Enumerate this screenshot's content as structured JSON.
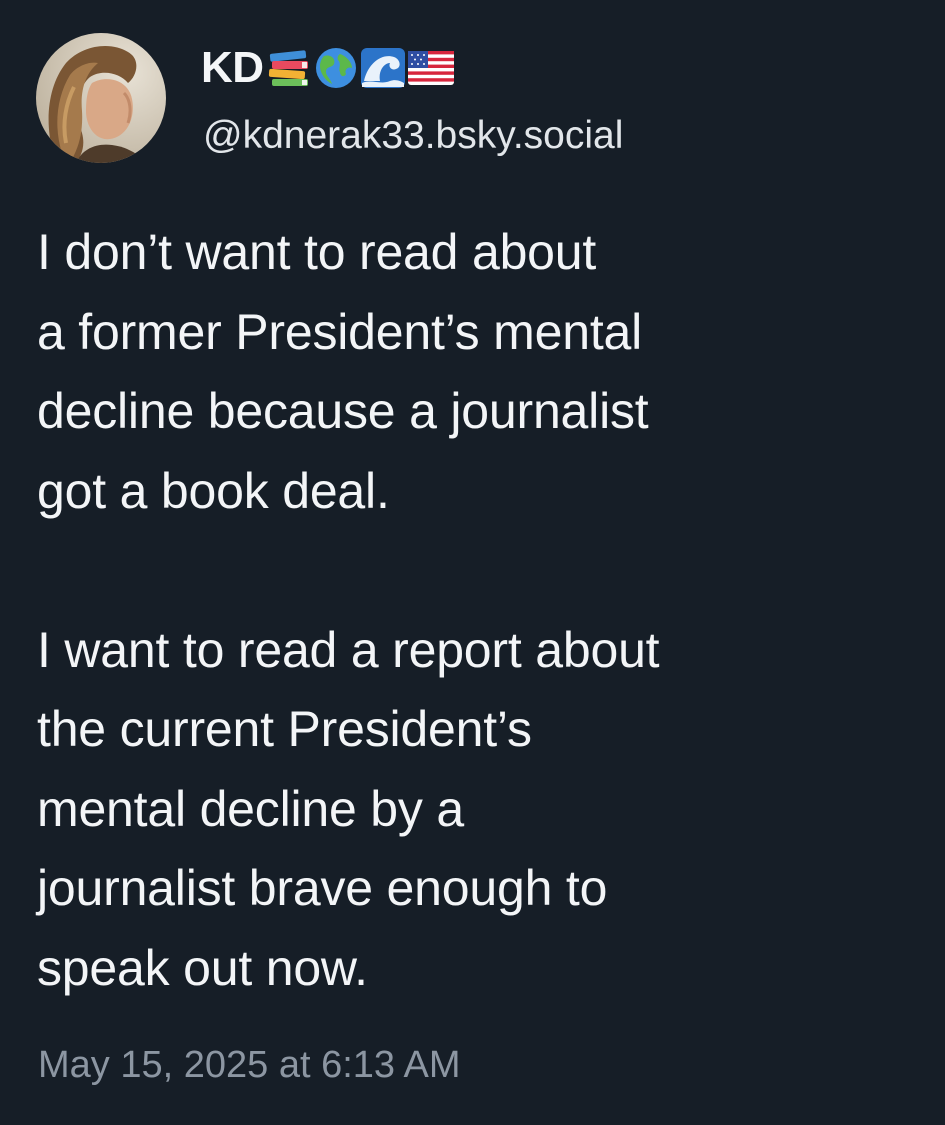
{
  "author": {
    "display_name": "KD",
    "name_emojis": [
      "books-emoji",
      "earth-americas-emoji",
      "water-wave-emoji",
      "us-flag-emoji"
    ],
    "handle": "@kdnerak33.bsky.social"
  },
  "post": {
    "paragraphs": [
      "I don’t want to read about\na former President’s mental\ndecline because a journalist\ngot a book deal.",
      "I want to read a report about\nthe current President’s\nmental decline by a\njournalist brave enough to\nspeak out now."
    ],
    "timestamp": "May 15, 2025 at 6:13 AM"
  },
  "colors": {
    "background": "#161e27",
    "text": "#f3f5f7",
    "muted": "#8c96a2"
  }
}
